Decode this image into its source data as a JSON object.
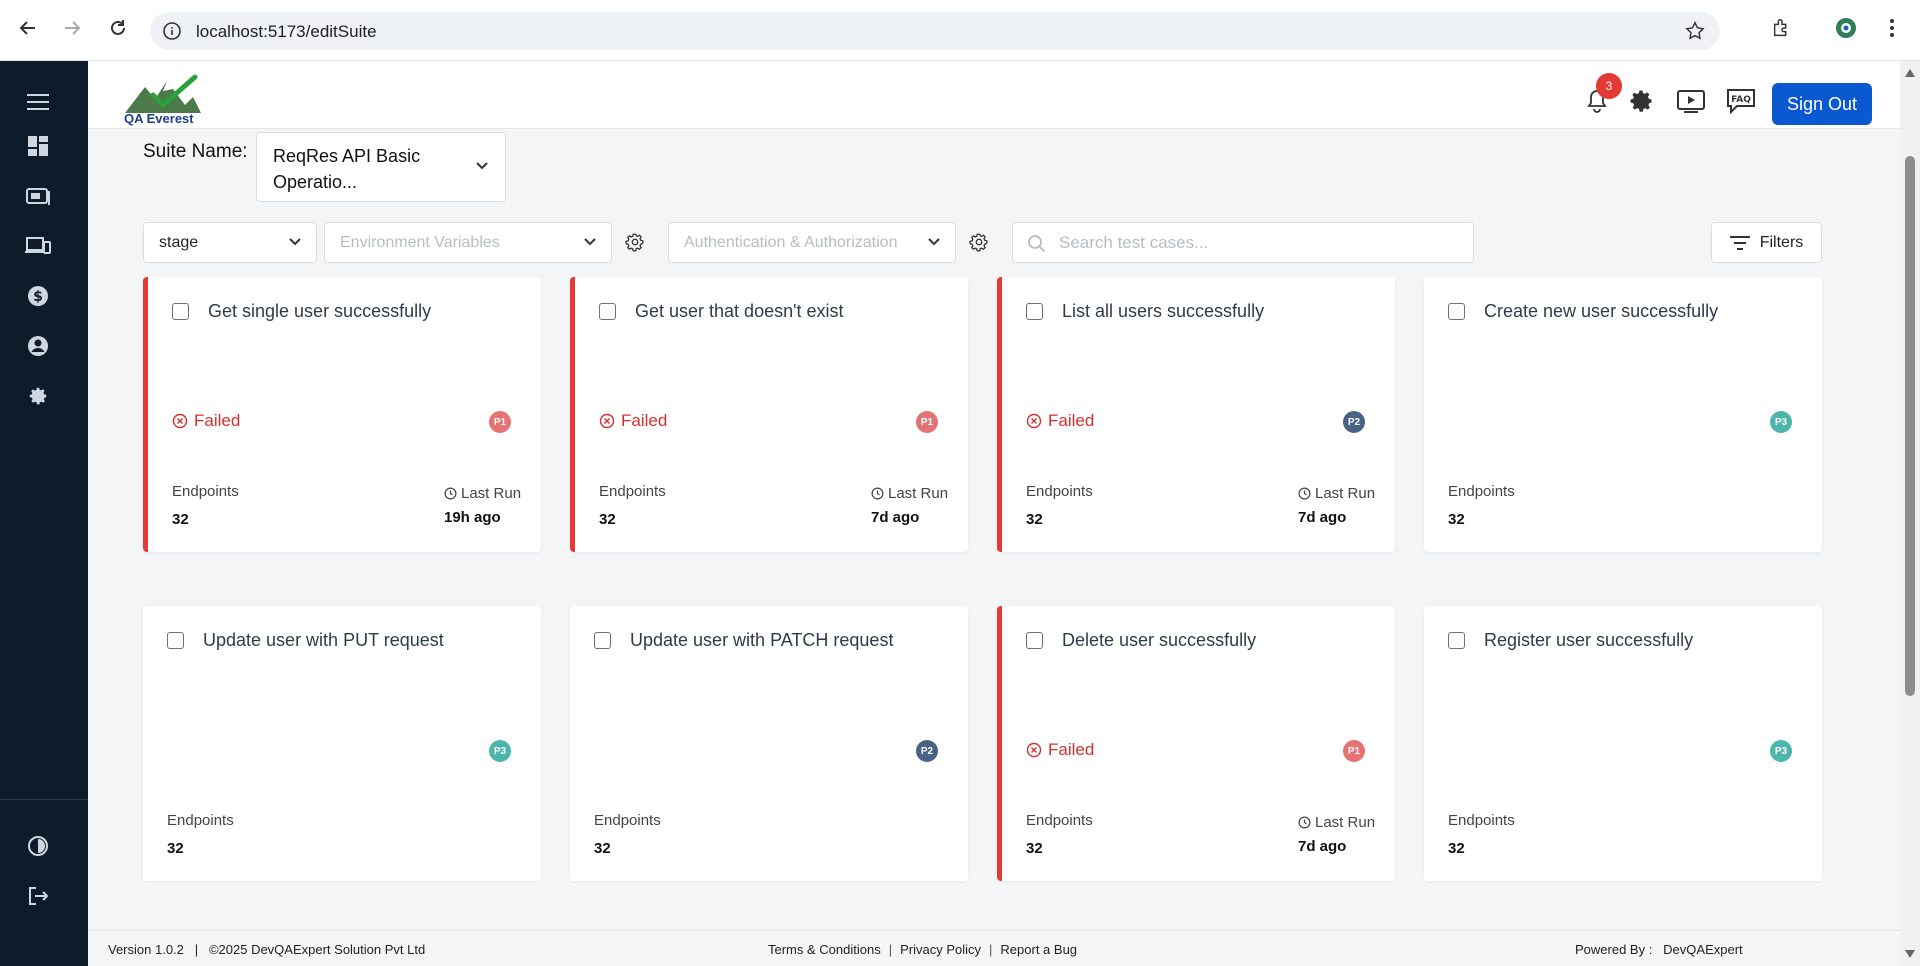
{
  "browser": {
    "url": "localhost:5173/editSuite"
  },
  "header": {
    "logo_text": "QA Everest",
    "notification_count": "3",
    "faq_label": "FAQ",
    "signout_label": "Sign Out"
  },
  "suite": {
    "label": "Suite Name:",
    "value": "ReqRes API Basic Operatio..."
  },
  "filters": {
    "stage_value": "stage",
    "env_placeholder": "Environment Variables",
    "auth_placeholder": "Authentication & Authorization",
    "search_placeholder": "Search test cases...",
    "filters_label": "Filters"
  },
  "cards": [
    {
      "title": "Get single user successfully",
      "status": "Failed",
      "priority": "P1",
      "endpoints_label": "Endpoints",
      "endpoints": "32",
      "last_run_label": "Last Run",
      "last_run": "19h ago"
    },
    {
      "title": "Get user that doesn't exist",
      "status": "Failed",
      "priority": "P1",
      "endpoints_label": "Endpoints",
      "endpoints": "32",
      "last_run_label": "Last Run",
      "last_run": "7d ago"
    },
    {
      "title": "List all users successfully",
      "status": "Failed",
      "priority": "P2",
      "endpoints_label": "Endpoints",
      "endpoints": "32",
      "last_run_label": "Last Run",
      "last_run": "7d ago"
    },
    {
      "title": "Create new user successfully",
      "status": "",
      "priority": "P3",
      "endpoints_label": "Endpoints",
      "endpoints": "32",
      "last_run_label": "",
      "last_run": ""
    },
    {
      "title": "Update user with PUT request",
      "status": "",
      "priority": "P3",
      "endpoints_label": "Endpoints",
      "endpoints": "32",
      "last_run_label": "",
      "last_run": ""
    },
    {
      "title": "Update user with PATCH request",
      "status": "",
      "priority": "P2",
      "endpoints_label": "Endpoints",
      "endpoints": "32",
      "last_run_label": "",
      "last_run": ""
    },
    {
      "title": "Delete user successfully",
      "status": "Failed",
      "priority": "P1",
      "endpoints_label": "Endpoints",
      "endpoints": "32",
      "last_run_label": "Last Run",
      "last_run": "7d ago"
    },
    {
      "title": "Register user successfully",
      "status": "",
      "priority": "P3",
      "endpoints_label": "Endpoints",
      "endpoints": "32",
      "last_run_label": "",
      "last_run": ""
    }
  ],
  "colors": {
    "failed": "#e53935",
    "p1": "#e57373",
    "p2": "#4a6385",
    "p3": "#4db6ac",
    "brand": "#0b59d1",
    "sidebar": "#0e1b2b"
  },
  "footer": {
    "version": "Version 1.0.2",
    "copyright": "©2025 DevQAExpert Solution Pvt Ltd",
    "terms": "Terms & Conditions",
    "privacy": "Privacy Policy",
    "report": "Report a Bug",
    "powered_label": "Powered By :",
    "powered_value": "DevQAExpert"
  }
}
